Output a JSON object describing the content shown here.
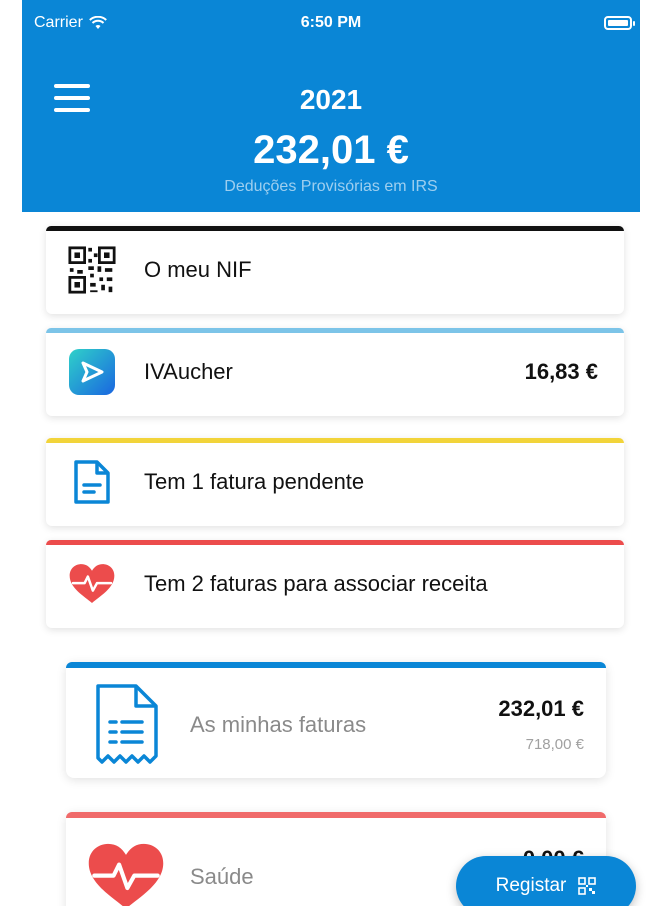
{
  "status_bar": {
    "carrier": "Carrier",
    "time": "6:50 PM"
  },
  "header": {
    "year": "2021",
    "total": "232,01 €",
    "subtitle": "Deduções Provisórias em IRS"
  },
  "cards": {
    "nif": {
      "label": "O meu NIF",
      "bar_color": "#111111"
    },
    "ivaucher": {
      "label": "IVAucher",
      "amount": "16,83 €",
      "bar_color": "#7cc4e8"
    },
    "pending": {
      "label": "Tem 1 fatura pendente",
      "bar_color": "#f2d43a"
    },
    "prescription": {
      "label": "Tem 2 faturas para associar receita",
      "bar_color": "#ec4c4c"
    }
  },
  "sections": {
    "invoices": {
      "label": "As minhas faturas",
      "amount": "232,01 €",
      "sub_amount": "718,00 €",
      "bar_color": "#0a86d6"
    },
    "health": {
      "label": "Saúde",
      "amount": "0,00 €",
      "bar_color": "#f06a6a"
    }
  },
  "fab": {
    "label": "Registar"
  },
  "colors": {
    "primary": "#0a86d6",
    "heart": "#ec4c4c",
    "ivaucher_icon": "#1a8ee0"
  }
}
